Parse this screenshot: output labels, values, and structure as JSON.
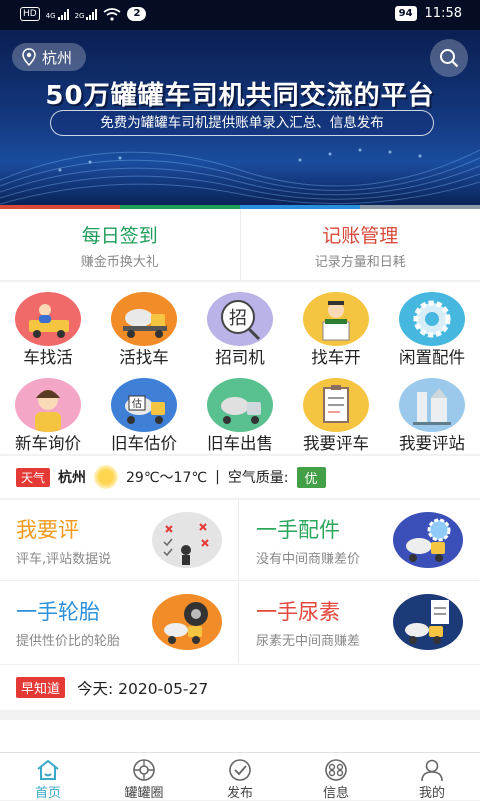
{
  "status_bar": {
    "hd": "HD",
    "net1": "4G",
    "net2": "2G",
    "notifications": "2",
    "battery": "94",
    "time": "11:58"
  },
  "banner": {
    "location": "杭州",
    "headline": "50万罐罐车司机共同交流的平台",
    "subline": "免费为罐罐车司机提供账单录入汇总、信息发布"
  },
  "quick_actions": [
    {
      "title": "每日签到",
      "subtitle": "赚金币换大礼",
      "color": "#1f9d5a"
    },
    {
      "title": "记账管理",
      "subtitle": "记录方量和日耗",
      "color": "#d84a3a"
    }
  ],
  "grid_rows": [
    [
      {
        "label": "车找活",
        "icon": "truck-driver-icon"
      },
      {
        "label": "活找车",
        "icon": "mixer-truck-icon"
      },
      {
        "label": "招司机",
        "icon": "recruit-icon"
      },
      {
        "label": "找车开",
        "icon": "driver-certificate-icon"
      },
      {
        "label": "闲置配件",
        "icon": "gear-parts-icon"
      }
    ],
    [
      {
        "label": "新车询价",
        "icon": "customer-service-icon"
      },
      {
        "label": "旧车估价",
        "icon": "appraisal-truck-icon"
      },
      {
        "label": "旧车出售",
        "icon": "used-truck-icon"
      },
      {
        "label": "我要评车",
        "icon": "review-clipboard-icon"
      },
      {
        "label": "我要评站",
        "icon": "mixing-plant-icon"
      }
    ]
  ],
  "weather": {
    "tag": "天气",
    "city": "杭州",
    "temp": "29℃～17℃",
    "sep": "|",
    "aqi_label": "空气质量:",
    "aqi_value": "优"
  },
  "cards": [
    {
      "title": "我要评",
      "subtitle": "评车,评站数据说",
      "color": "#f39a1e"
    },
    {
      "title": "一手配件",
      "subtitle": "没有中间商赚差价",
      "color": "#2aa75d"
    },
    {
      "title": "一手轮胎",
      "subtitle": "提供性价比的轮胎",
      "color": "#2b8fdb"
    },
    {
      "title": "一手尿素",
      "subtitle": "尿素无中间商赚差",
      "color": "#e4473c"
    }
  ],
  "news": {
    "tag": "早知道",
    "text": "今天:  2020-05-27"
  },
  "tabs": [
    {
      "label": "首页",
      "icon": "home-icon"
    },
    {
      "label": "罐罐圈",
      "icon": "circle-community-icon"
    },
    {
      "label": "发布",
      "icon": "publish-icon"
    },
    {
      "label": "信息",
      "icon": "message-icon"
    },
    {
      "label": "我的",
      "icon": "profile-icon"
    }
  ],
  "colors": {
    "accent": "#3aa9c9",
    "bar": [
      "#d84a3a",
      "#1f9d5a",
      "#2b8fdb",
      "#8c9aa8"
    ]
  }
}
